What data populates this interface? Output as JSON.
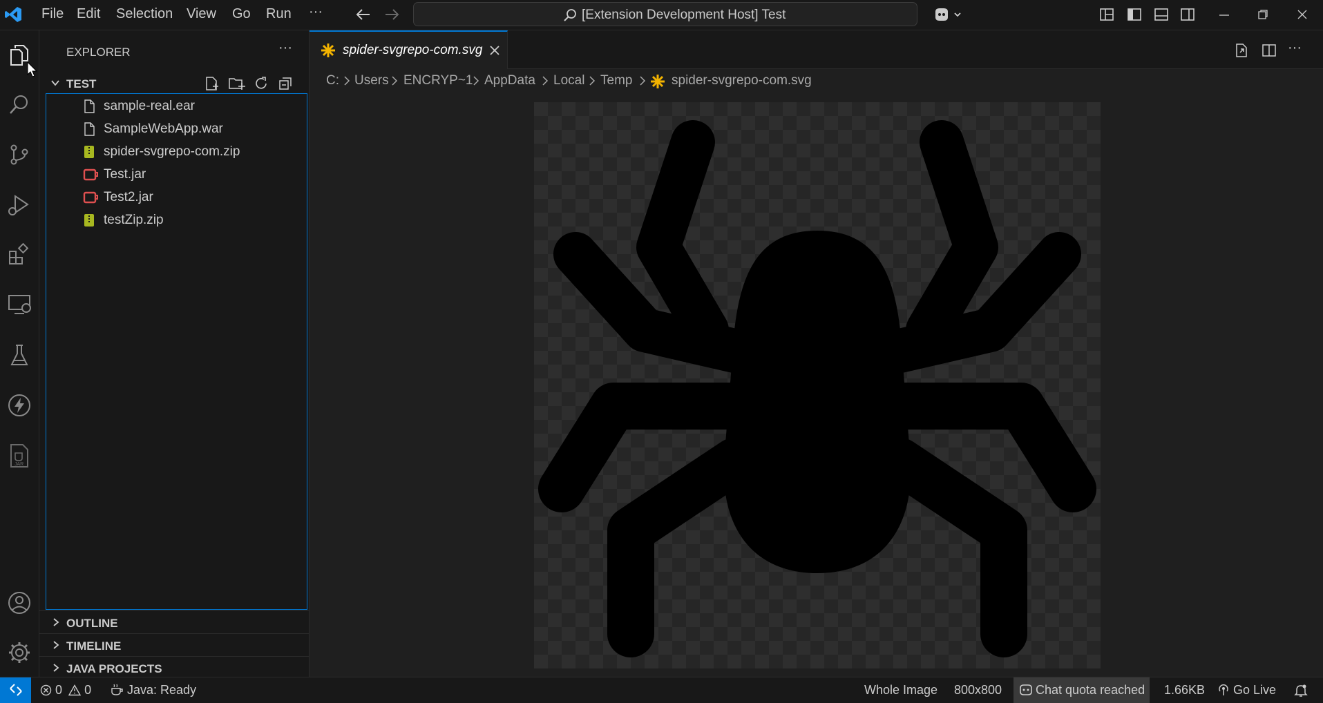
{
  "titlebar": {
    "menu": [
      "File",
      "Edit",
      "Selection",
      "View",
      "Go",
      "Run"
    ],
    "more": "···",
    "command_center": "[Extension Development Host] Test"
  },
  "activity_bar": {
    "items": [
      "explorer-icon",
      "search-icon",
      "source-control-icon",
      "run-debug-icon",
      "extensions-icon",
      "remote-explorer-icon",
      "testing-icon",
      "lightning-icon",
      "jar-viewer-icon"
    ],
    "bottom": [
      "accounts-icon",
      "manage-gear-icon"
    ]
  },
  "sidebar": {
    "title": "EXPLORER",
    "folder": "TEST",
    "files": [
      {
        "name": "sample-real.ear",
        "icon": "file"
      },
      {
        "name": "SampleWebApp.war",
        "icon": "file"
      },
      {
        "name": "spider-svgrepo-com.zip",
        "icon": "zip"
      },
      {
        "name": "Test.jar",
        "icon": "jar"
      },
      {
        "name": "Test2.jar",
        "icon": "jar"
      },
      {
        "name": "testZip.zip",
        "icon": "zip"
      }
    ],
    "sections": [
      "OUTLINE",
      "TIMELINE",
      "JAVA PROJECTS"
    ]
  },
  "editor": {
    "tab_label": "spider-svgrepo-com.svg",
    "breadcrumbs": [
      "C:",
      "Users",
      "ENCRYP~1",
      "AppData",
      "Local",
      "Temp",
      "spider-svgrepo-com.svg"
    ]
  },
  "statusbar": {
    "errors": "0",
    "warnings": "0",
    "java": "Java: Ready",
    "zoom": "Whole Image",
    "dimensions": "800x800",
    "chat": "Chat quota reached",
    "size": "1.66KB",
    "golive": "Go Live"
  },
  "colors": {
    "accent": "#0078d4",
    "svg_icon": "#f4b400",
    "zip_icon": "#a8b820",
    "jar_icon": "#e05050",
    "remote_button": "#0078d4"
  }
}
